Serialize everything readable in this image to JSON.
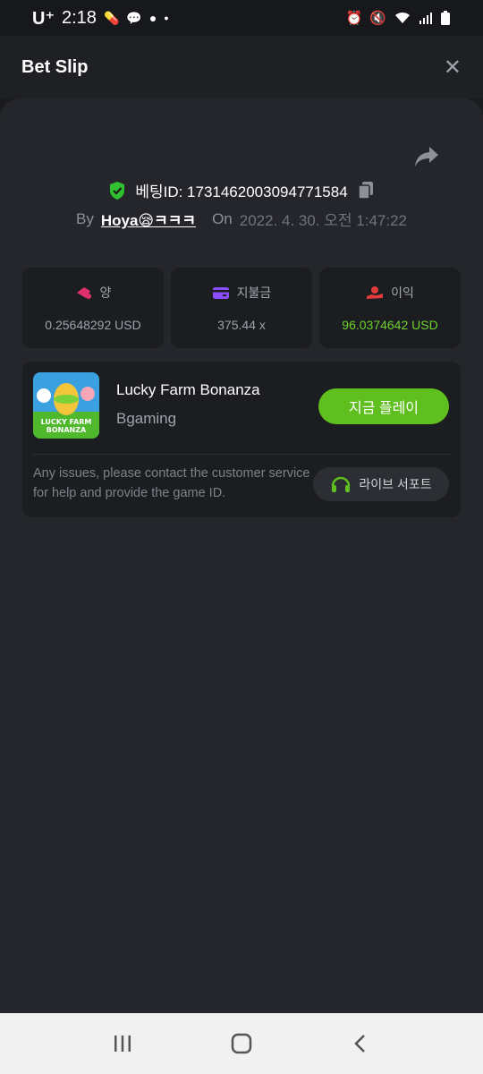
{
  "status_bar": {
    "carrier": "U⁺",
    "time": "2:18",
    "left_icons": [
      "pill-icon",
      "talk-icon",
      "chat-bubble-icon",
      "dot-icon"
    ],
    "right_icons": [
      "alarm-icon",
      "mute-icon",
      "wifi-icon",
      "signal-icon",
      "battery-icon"
    ]
  },
  "header": {
    "title": "Bet Slip"
  },
  "bet": {
    "id_label": "베팅ID: 1731462003094771584",
    "by_label": "By",
    "user": "Hoya😪ㅋㅋㅋ",
    "on_label": "On",
    "date": "2022. 4. 30. 오전 1:47:22"
  },
  "stats": [
    {
      "label": "양",
      "value": "0.25648292 USD",
      "icon": "amount-icon"
    },
    {
      "label": "지불금",
      "value": "375.44 x",
      "icon": "wallet-icon"
    },
    {
      "label": "이익",
      "value": "96.0374642 USD",
      "icon": "profit-icon"
    }
  ],
  "game": {
    "name": "Lucky Farm Bonanza",
    "provider": "Bgaming",
    "thumb_text_line1": "LUCKY FARM",
    "thumb_text_line2": "BONANZA",
    "play_label": "지금 플레이",
    "help_text": "Any issues, please contact the customer service for help and provide the game ID.",
    "support_label": "라이브 서포트"
  },
  "colors": {
    "accent_green": "#5fbf1e",
    "profit_green": "#6ed12c",
    "amount_pink": "#e0306a",
    "wallet_purple": "#8a4dff",
    "profit_red": "#e23b3b"
  }
}
